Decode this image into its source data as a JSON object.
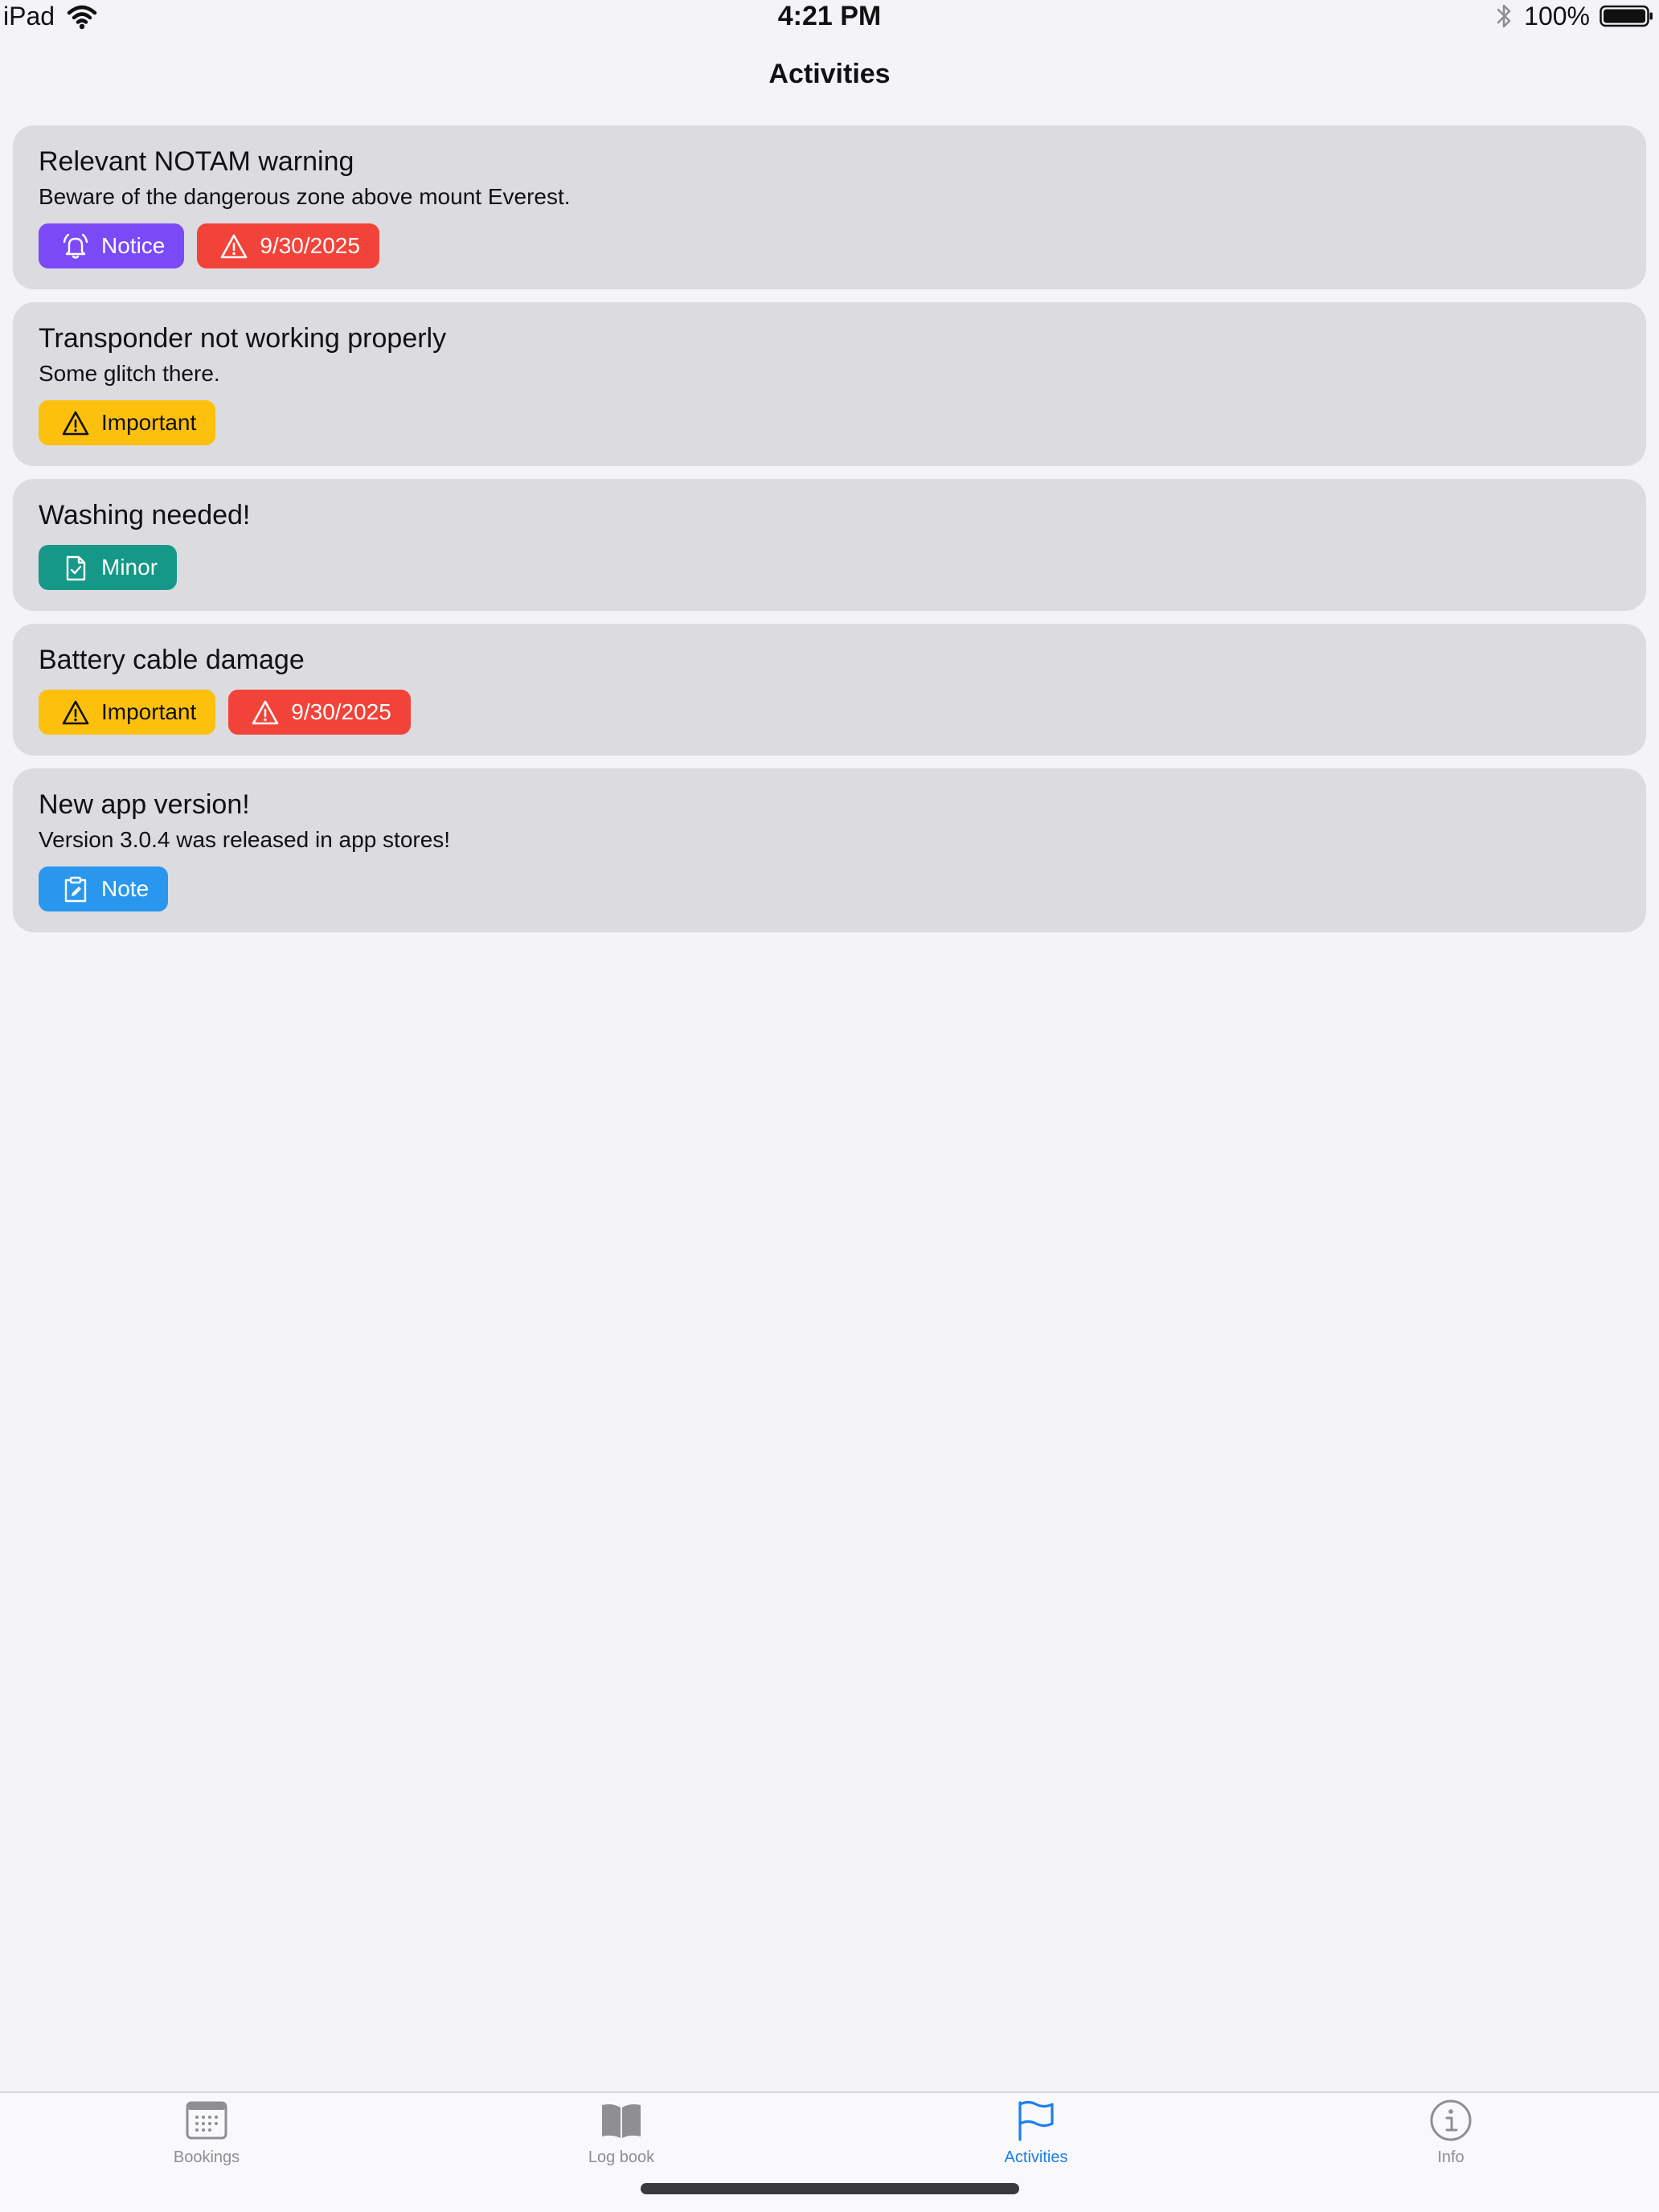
{
  "status_bar": {
    "device": "iPad",
    "time": "4:21 PM",
    "battery": "100%"
  },
  "nav": {
    "title": "Activities"
  },
  "activities": [
    {
      "title": "Relevant NOTAM warning",
      "description": "Beware of the dangerous zone above mount Everest.",
      "tags": [
        {
          "label": "Notice",
          "kind": "notice",
          "icon": "bell-ringing-icon",
          "color": "#7b4af7"
        },
        {
          "label": "9/30/2025",
          "kind": "due",
          "icon": "warning-triangle-icon",
          "color": "#f2433a"
        }
      ]
    },
    {
      "title": "Transponder not working properly",
      "description": "Some glitch there.",
      "tags": [
        {
          "label": "Important",
          "kind": "important",
          "icon": "warning-triangle-icon",
          "color": "#fdc00c"
        }
      ]
    },
    {
      "title": "Washing needed!",
      "description": "",
      "tags": [
        {
          "label": "Minor",
          "kind": "minor",
          "icon": "document-check-icon",
          "color": "#159888"
        }
      ]
    },
    {
      "title": "Battery cable damage",
      "description": "",
      "tags": [
        {
          "label": "Important",
          "kind": "important",
          "icon": "warning-triangle-icon",
          "color": "#fdc00c"
        },
        {
          "label": "9/30/2025",
          "kind": "due",
          "icon": "warning-triangle-icon",
          "color": "#f2433a"
        }
      ]
    },
    {
      "title": "New app version!",
      "description": "Version 3.0.4 was released in app stores!",
      "tags": [
        {
          "label": "Note",
          "kind": "note",
          "icon": "clipboard-edit-icon",
          "color": "#2a97ee"
        }
      ]
    }
  ],
  "tab_bar": {
    "active": "Activities",
    "active_color": "#1a7ef0",
    "items": [
      {
        "label": "Bookings",
        "icon": "calendar-icon"
      },
      {
        "label": "Log book",
        "icon": "book-icon"
      },
      {
        "label": "Activities",
        "icon": "flag-icon"
      },
      {
        "label": "Info",
        "icon": "info-icon"
      }
    ]
  }
}
